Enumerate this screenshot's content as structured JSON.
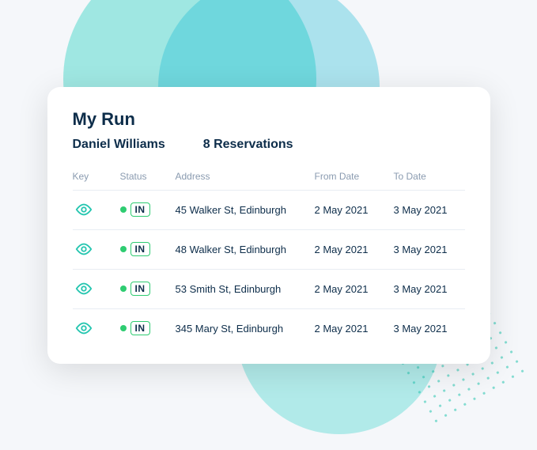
{
  "background": {
    "circle1": {},
    "circle2": {},
    "circle3": {}
  },
  "card": {
    "title": "My Run",
    "user_name": "Daniel Williams",
    "reservations_label": "8 Reservations",
    "table": {
      "columns": [
        "Key",
        "Status",
        "Address",
        "From Date",
        "To Date"
      ],
      "rows": [
        {
          "status": "IN",
          "address": "45 Walker St, Edinburgh",
          "from_date": "2 May 2021",
          "to_date": "3 May 2021"
        },
        {
          "status": "IN",
          "address": "48 Walker St, Edinburgh",
          "from_date": "2 May 2021",
          "to_date": "3 May 2021"
        },
        {
          "status": "IN",
          "address": "53 Smith St, Edinburgh",
          "from_date": "2 May 2021",
          "to_date": "3 May 2021"
        },
        {
          "status": "IN",
          "address": "345 Mary St, Edinburgh",
          "from_date": "2 May 2021",
          "to_date": "3 May 2021"
        }
      ]
    }
  }
}
